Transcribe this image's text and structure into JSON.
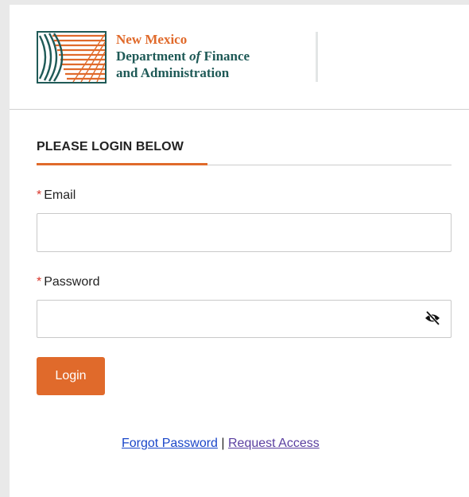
{
  "logo": {
    "line1": "New Mexico",
    "line2_pre": "Department ",
    "line2_of": "of",
    "line2_post": " Finance",
    "line3": "and Administration",
    "icon": "nm-dfa-sunrise-logo-icon"
  },
  "form": {
    "title": "PLEASE LOGIN BELOW",
    "required_mark": "*",
    "email_label": "Email",
    "email_value": "",
    "email_placeholder": "",
    "password_label": "Password",
    "password_value": "",
    "password_placeholder": "",
    "visibility_icon": "eye-slash-icon",
    "login_label": "Login"
  },
  "links": {
    "forgot": "Forgot Password",
    "separator": "|",
    "request": "Request Access"
  },
  "colors": {
    "accent": "#e06a2b",
    "brand_teal": "#1f5a57",
    "required": "#d9362b",
    "link": "#1a47c9",
    "visited_link": "#5a3fa0"
  }
}
